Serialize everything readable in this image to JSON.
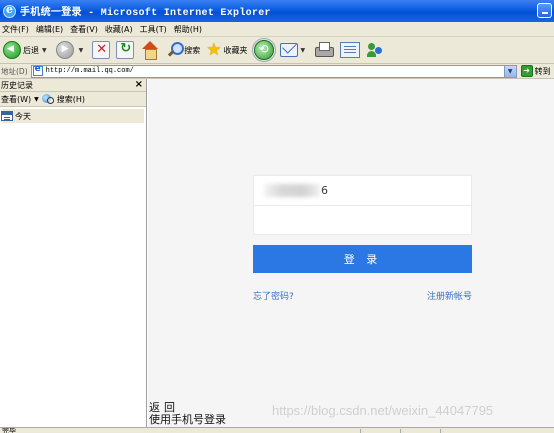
{
  "window": {
    "title": "手机统一登录 - Microsoft Internet Explorer"
  },
  "menubar": {
    "items": [
      "文件(F)",
      "编辑(E)",
      "查看(V)",
      "收藏(A)",
      "工具(T)",
      "帮助(H)"
    ]
  },
  "toolbar": {
    "back_label": "后退",
    "search_label": "搜索",
    "favorites_label": "收藏夹"
  },
  "addressbar": {
    "label": "地址(D)",
    "url": "http://m.mail.qq.com/",
    "go_label": "转到"
  },
  "sidebar": {
    "title": "历史记录",
    "close_glyph": "×",
    "view_label": "查看(W)",
    "search_label": "搜索(H)",
    "items": [
      {
        "label": "今天"
      }
    ]
  },
  "login": {
    "account_suffix": "6",
    "password_value": "",
    "login_label": "登 录",
    "forgot_label": "忘了密码?",
    "register_label": "注册新帐号"
  },
  "footer_links": {
    "back_label": "返回",
    "phone_login_label": "使用手机号登录"
  },
  "watermark": {
    "text": "https://blog.csdn.net/weixin_44047795"
  },
  "statusbar": {
    "text": "完毕"
  },
  "colors": {
    "titlebar": "#0a5de0",
    "chrome": "#ece9d8",
    "login_button": "#2b78e4",
    "link": "#3b6fbf",
    "content_bg": "#f5f5f5"
  }
}
